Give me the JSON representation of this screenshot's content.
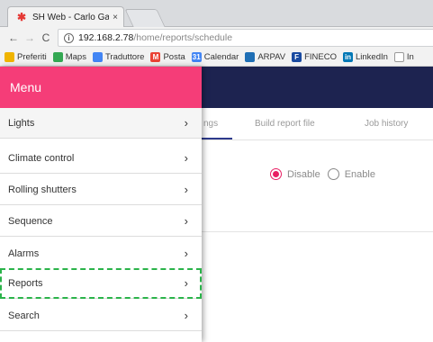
{
  "browser": {
    "tab_title": "SH Web - Carlo Gavazzi",
    "tab_close": "×",
    "url_host": "192.168.2.78",
    "url_path": "/home/reports/schedule",
    "bookmarks": [
      {
        "label": "Preferiti",
        "icon": "folder-icon",
        "color": "#f0b400"
      },
      {
        "label": "Maps",
        "icon": "maps-icon",
        "color": "#34a853"
      },
      {
        "label": "Traduttore",
        "icon": "translate-icon",
        "color": "#4285f4"
      },
      {
        "label": "Posta",
        "icon": "gmail-icon",
        "color": "#ea4335"
      },
      {
        "label": "Calendar",
        "icon": "calendar-icon",
        "color": "#4285f4"
      },
      {
        "label": "ARPAV",
        "icon": "arpav-icon",
        "color": "#1f6fb5"
      },
      {
        "label": "FINECO",
        "icon": "fineco-icon",
        "color": "#1a4aa0"
      },
      {
        "label": "LinkedIn",
        "icon": "linkedin-icon",
        "color": "#0077b5"
      },
      {
        "label": "In",
        "icon": "page-icon",
        "color": "#999999"
      }
    ]
  },
  "app": {
    "tabs": [
      {
        "label": "ngs"
      },
      {
        "label": "Build report file"
      },
      {
        "label": "Job history"
      }
    ],
    "radio_options": [
      {
        "label": "Disable",
        "checked": true
      },
      {
        "label": "Enable",
        "checked": false
      }
    ]
  },
  "menu": {
    "title": "Menu",
    "items": [
      {
        "label": "Lights"
      },
      {
        "label": "Climate control"
      },
      {
        "label": "Rolling shutters"
      },
      {
        "label": "Sequence"
      },
      {
        "label": "Alarms"
      },
      {
        "label": "Reports",
        "selected": true
      },
      {
        "label": "Search"
      }
    ],
    "chevron": "›"
  },
  "colors": {
    "menu_header": "#f53d78",
    "appbar": "#1d2350",
    "radio_accent": "#e91e63",
    "selection_outline": "#2bb34a"
  }
}
